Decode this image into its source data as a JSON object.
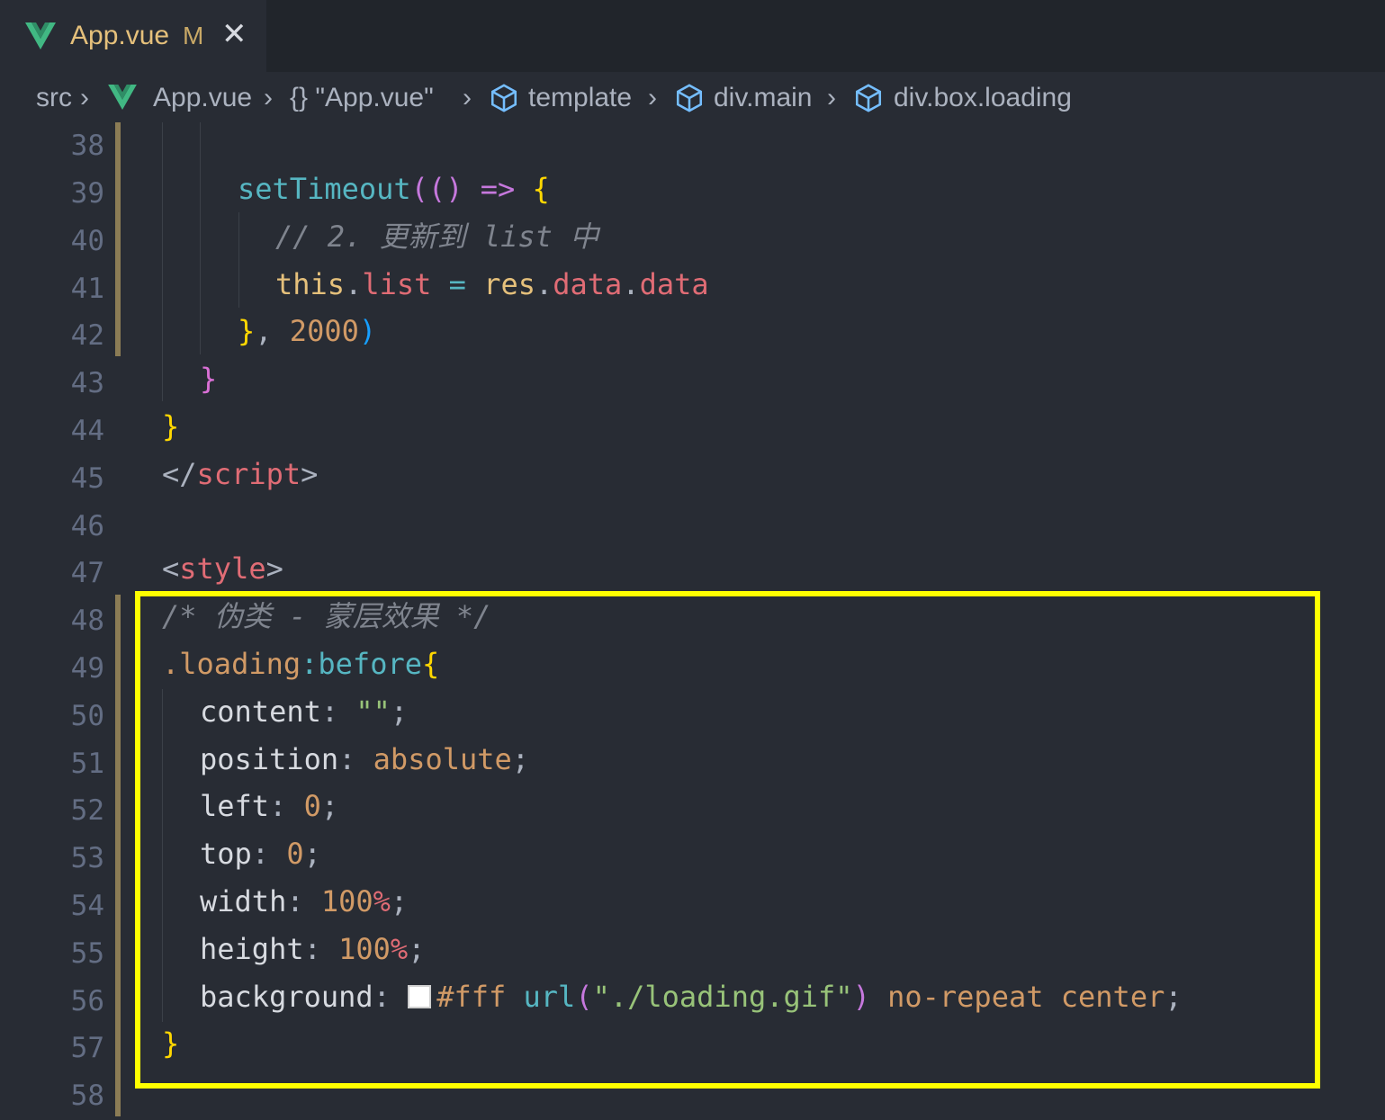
{
  "tab": {
    "icon": "vue-icon",
    "filename": "App.vue",
    "status": "M",
    "close": "✕"
  },
  "breadcrumb": {
    "folder": "src",
    "file": "App.vue",
    "object": "{} \"App.vue\"",
    "element1": "template",
    "element2": "div.main",
    "element3": "div.box.loading"
  },
  "editor": {
    "lines": [
      {
        "n": "38"
      },
      {
        "n": "39"
      },
      {
        "n": "40"
      },
      {
        "n": "41"
      },
      {
        "n": "42"
      },
      {
        "n": "43"
      },
      {
        "n": "44"
      },
      {
        "n": "45"
      },
      {
        "n": "46"
      },
      {
        "n": "47"
      },
      {
        "n": "48"
      },
      {
        "n": "49"
      },
      {
        "n": "50"
      },
      {
        "n": "51"
      },
      {
        "n": "52"
      },
      {
        "n": "53"
      },
      {
        "n": "54"
      },
      {
        "n": "55"
      },
      {
        "n": "56"
      },
      {
        "n": "57"
      },
      {
        "n": "58"
      }
    ],
    "code": {
      "l39_fn": "setTimeout",
      "l39_paren": "(()",
      "l39_arrow": " => ",
      "l39_brace": "{",
      "l40_comment": "// 2. 更新到 list 中",
      "l41_this": "this",
      "l41_dot1": ".",
      "l41_list": "list",
      "l41_eq": " = ",
      "l41_res": "res",
      "l41_dot2": ".",
      "l41_data1": "data",
      "l41_dot3": ".",
      "l41_data2": "data",
      "l42_brace": "}",
      "l42_comma": ", ",
      "l42_num": "2000",
      "l42_paren": ")",
      "l43_brace": "}",
      "l44_brace": "}",
      "l45_open": "</",
      "l45_tag": "script",
      "l45_close": ">",
      "l47_open": "<",
      "l47_tag": "style",
      "l47_close": ">",
      "l48_comment": "/* 伪类 - 蒙层效果 */",
      "l49_sel": ".loading",
      "l49_colon": ":",
      "l49_pseudo": "before",
      "l49_brace": "{",
      "l50_prop": "content",
      "l50_colon": ": ",
      "l50_val": "\"\"",
      "l50_semi": ";",
      "l51_prop": "position",
      "l51_colon": ": ",
      "l51_val": "absolute",
      "l51_semi": ";",
      "l52_prop": "left",
      "l52_colon": ": ",
      "l52_val": "0",
      "l52_semi": ";",
      "l53_prop": "top",
      "l53_colon": ": ",
      "l53_val": "0",
      "l53_semi": ";",
      "l54_prop": "width",
      "l54_colon": ": ",
      "l54_num": "100",
      "l54_unit": "%",
      "l54_semi": ";",
      "l55_prop": "height",
      "l55_colon": ": ",
      "l55_num": "100",
      "l55_unit": "%",
      "l55_semi": ";",
      "l56_prop": "background",
      "l56_colon": ": ",
      "l56_color": "#fff",
      "l56_url": "url",
      "l56_popen": "(",
      "l56_str": "\"./loading.gif\"",
      "l56_pclose": ")",
      "l56_rest": " no-repeat center",
      "l56_semi": ";",
      "l57_brace": "}"
    }
  },
  "colors": {
    "editor_bg": "#282c34",
    "tabbar_bg": "#21252b",
    "highlight": "#ffff00",
    "vue_green": "#41b883",
    "swatch": "#ffffff"
  }
}
